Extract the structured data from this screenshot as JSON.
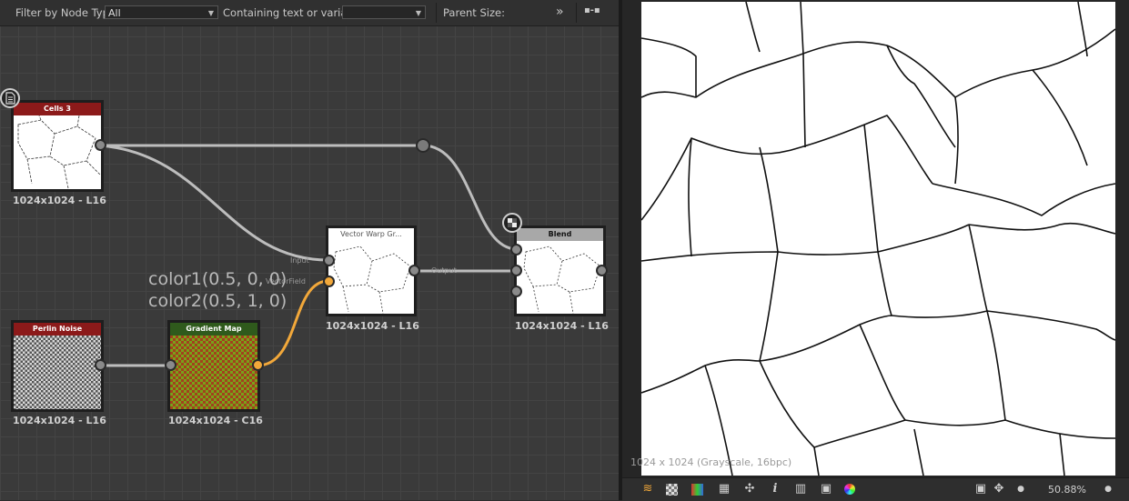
{
  "toolbar": {
    "filter_label": "Filter by Node Type",
    "filter_value": "All",
    "containing_label": "Containing text or variable",
    "containing_value": "",
    "parent_size_label": "Parent Size:",
    "expand_glyph": "»",
    "link_glyph": "▪-▪"
  },
  "nodes": {
    "cells": {
      "title": "Cells 3",
      "resolution": "1024x1024 - L16",
      "header_color": "#8c1a1a"
    },
    "perlin": {
      "title": "Perlin Noise",
      "resolution": "1024x1024 - L16",
      "header_color": "#8c1a1a"
    },
    "gradient": {
      "title": "Gradient Map",
      "resolution": "1024x1024 - C16",
      "header_color": "#2f5a1c"
    },
    "vector": {
      "title": "Vector Warp Gr...",
      "resolution": "1024x1024 - L16",
      "header_color": "#ffffff",
      "pin_input": "Input",
      "pin_vector": "VectorField",
      "pin_output": "Output"
    },
    "blend": {
      "title": "Blend",
      "resolution": "1024x1024 - L16",
      "header_color": "#a8a8a8"
    }
  },
  "annotation": {
    "line1": "color1(0.5, 0, 0)",
    "line2": "color2(0.5, 1, 0)"
  },
  "viewer": {
    "info": "1024 x 1024 (Grayscale, 16bpc)",
    "zoom": "50.88%"
  },
  "colors": {
    "wire_gray": "#bdbdbd",
    "wire_orange": "#f2a83a"
  }
}
